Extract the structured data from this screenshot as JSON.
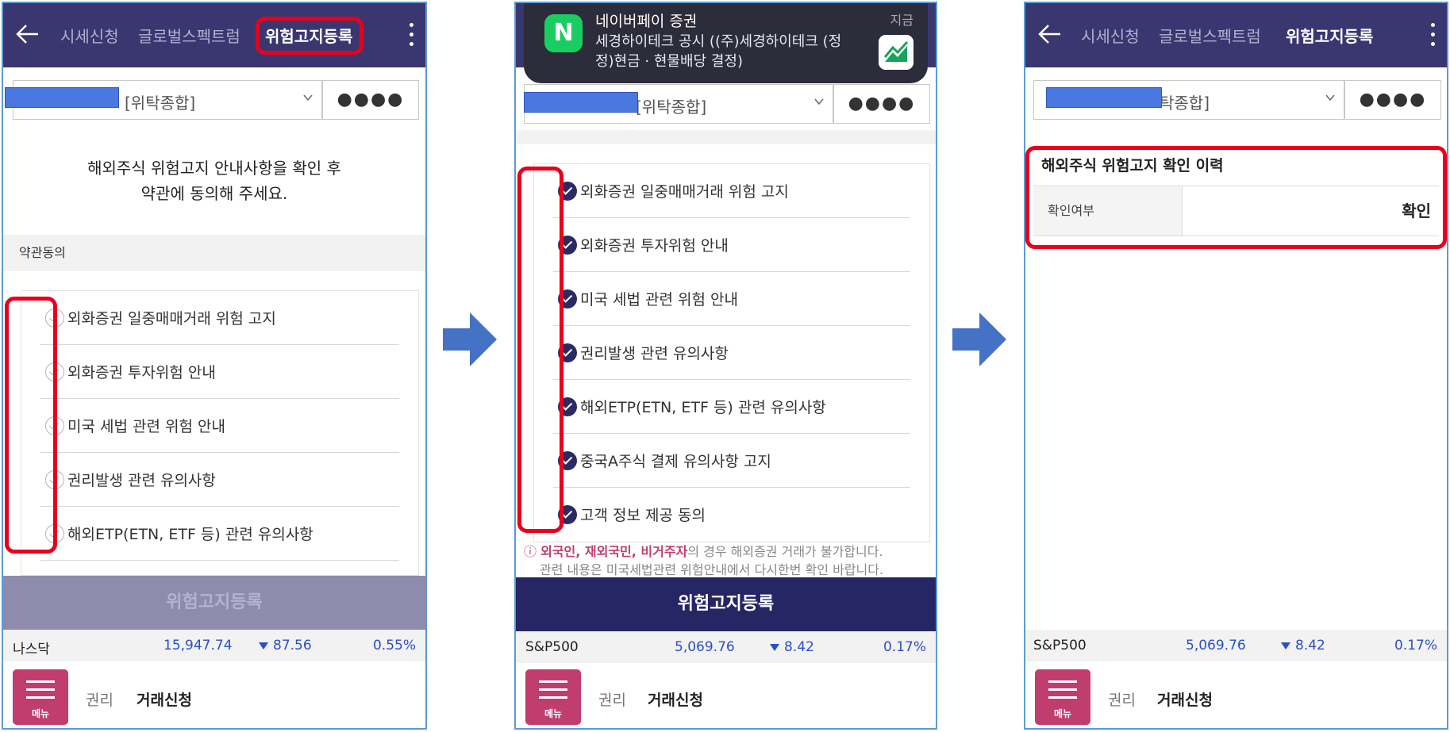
{
  "colors": {
    "header": "#3a3770",
    "primary_button": "#252663",
    "disabled_button": "#8f8bad",
    "menu": "#c03d6e",
    "highlight": "#e8001c",
    "flow_arrow": "#4472c4"
  },
  "screen1": {
    "tabs": [
      "시세신청",
      "글로벌스펙트럼",
      "위험고지등록"
    ],
    "account_label": "[위탁종합]",
    "password_mask": "●●●●",
    "intro_line1": "해외주식 위험고지 안내사항을 확인 후",
    "intro_line2": "약관에 동의해 주세요.",
    "section": "약관동의",
    "terms": [
      {
        "label": "외화증권 일중매매거래 위험 고지",
        "checked": false
      },
      {
        "label": "외화증권 투자위험 안내",
        "checked": false
      },
      {
        "label": "미국 세법 관련 위험 안내",
        "checked": false
      },
      {
        "label": "권리발생 관련 유의사항",
        "checked": false
      },
      {
        "label": "해외ETP(ETN, ETF 등) 관련 유의사항",
        "checked": false
      }
    ],
    "button": "위험고지등록",
    "ticker": {
      "name": "나스닥",
      "value": "15,947.74",
      "change": "87.56",
      "pct": "0.55%"
    },
    "menu_label": "메뉴",
    "nav1": "권리",
    "nav2": "거래신청"
  },
  "screen2": {
    "notification": {
      "app": "N",
      "title": "네이버페이 증권",
      "body": "세경하이테크 공시 ((주)세경하이테크 (정정)현금 · 현물배당 결정)",
      "time": "지금"
    },
    "account_label": "[위탁종합]",
    "password_mask": "●●●●",
    "terms": [
      {
        "label": "외화증권 일중매매거래 위험 고지",
        "checked": true
      },
      {
        "label": "외화증권 투자위험 안내",
        "checked": true
      },
      {
        "label": "미국 세법 관련 위험 안내",
        "checked": true
      },
      {
        "label": "권리발생 관련 유의사항",
        "checked": true
      },
      {
        "label": "해외ETP(ETN, ETF 등) 관련 유의사항",
        "checked": true
      },
      {
        "label": "중국A주식 결제 유의사항 고지",
        "checked": true
      },
      {
        "label": "고객 정보 제공 동의",
        "checked": true
      }
    ],
    "warning_bold": "외국인, 재외국민, 비거주자",
    "warning_rest": "의 경우 해외증권 거래가 불가합니다.",
    "warning_line2": "관련 내용은 미국세법관련 위험안내에서 다시한번 확인 바랍니다.",
    "button": "위험고지등록",
    "ticker": {
      "name": "S&P500",
      "value": "5,069.76",
      "change": "8.42",
      "pct": "0.17%"
    },
    "menu_label": "메뉴",
    "nav1": "권리",
    "nav2": "거래신청"
  },
  "screen3": {
    "tabs": [
      "시세신청",
      "글로벌스펙트럼",
      "위험고지등록"
    ],
    "account_label": "탁종합]",
    "password_mask": "●●●●",
    "history_title": "해외주식 위험고지 확인 이력",
    "history_key": "확인여부",
    "history_value": "확인",
    "ticker": {
      "name": "S&P500",
      "value": "5,069.76",
      "change": "8.42",
      "pct": "0.17%"
    },
    "menu_label": "메뉴",
    "nav1": "권리",
    "nav2": "거래신청"
  }
}
